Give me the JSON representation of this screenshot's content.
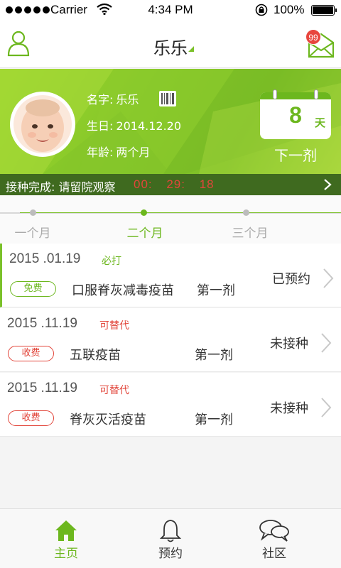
{
  "status_bar": {
    "carrier": "Carrier",
    "time": "4:34 PM",
    "battery": "100%"
  },
  "nav": {
    "title": "乐乐",
    "mail_badge": "99",
    "icons": {
      "left": "person-icon",
      "right": "mail-icon"
    }
  },
  "profile": {
    "name_label": "名字:",
    "name": "乐乐",
    "birthday_label": "生日:",
    "birthday": "2014.12.20",
    "age_label": "年龄:",
    "age": "两个月"
  },
  "next_dose": {
    "days": "8",
    "unit": "天",
    "label": "下一剂"
  },
  "observation": {
    "text": "接种完成: 请留院观察",
    "timer": "00: 29: 18"
  },
  "timeline": {
    "months": [
      {
        "label": "一个月",
        "active": false
      },
      {
        "label": "二个月",
        "active": true
      },
      {
        "label": "三个月",
        "active": false
      }
    ]
  },
  "vaccines": [
    {
      "date": "2015 .01.19",
      "tag": "必打",
      "tag_color": "#6cb71e",
      "fee": "免费",
      "fee_color": "#6cb71e",
      "name": "口服脊灰减毒疫苗",
      "dose": "第一剂",
      "status": "已预约"
    },
    {
      "date": "2015 .11.19",
      "tag": "可替代",
      "tag_color": "#e2463b",
      "fee": "收费",
      "fee_color": "#e2463b",
      "name": "五联疫苗",
      "dose": "第一剂",
      "status": "未接种"
    },
    {
      "date": "2015 .11.19",
      "tag": "可替代",
      "tag_color": "#e2463b",
      "fee": "收费",
      "fee_color": "#e2463b",
      "name": "脊灰灭活疫苗",
      "dose": "第一剂",
      "status": "未接种"
    }
  ],
  "tabs": [
    {
      "label": "主页",
      "icon": "home-icon",
      "active": true
    },
    {
      "label": "预约",
      "icon": "bell-icon",
      "active": false
    },
    {
      "label": "社区",
      "icon": "chat-icon",
      "active": false
    }
  ],
  "colors": {
    "accent": "#7bc12a",
    "alert": "#e2463b",
    "observation_bar": "#3f6a1f"
  }
}
